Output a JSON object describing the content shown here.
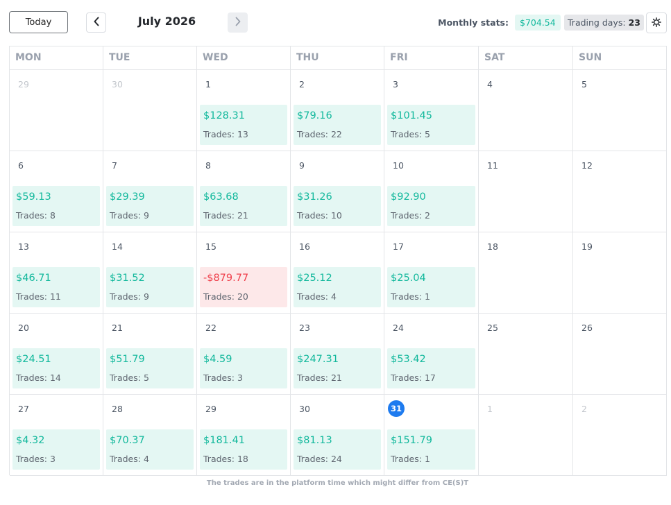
{
  "toolbar": {
    "today_label": "Today",
    "month_title": "July 2026",
    "stats_label": "Monthly stats:",
    "monthly_pnl": "$704.54",
    "trading_days_label": "Trading days:",
    "trading_days_value": "23",
    "icons": {
      "prev": "chevron-left-icon",
      "next": "chevron-right-icon",
      "settings": "gear-icon"
    }
  },
  "weekdays": [
    "MON",
    "TUE",
    "WED",
    "THU",
    "FRI",
    "SAT",
    "SUN"
  ],
  "trades_label": "Trades:",
  "colors": {
    "profit": "#12b89c",
    "profit_bg": "#e4f7f3",
    "loss": "#ef3e4a",
    "loss_bg": "#fde8e9",
    "today": "#1e7bef"
  },
  "weeks": [
    [
      {
        "day": "29",
        "muted": true
      },
      {
        "day": "30",
        "muted": true
      },
      {
        "day": "1",
        "pnl": "$128.31",
        "trades": "13"
      },
      {
        "day": "2",
        "pnl": "$79.16",
        "trades": "22"
      },
      {
        "day": "3",
        "pnl": "$101.45",
        "trades": "5"
      },
      {
        "day": "4"
      },
      {
        "day": "5"
      }
    ],
    [
      {
        "day": "6",
        "pnl": "$59.13",
        "trades": "8"
      },
      {
        "day": "7",
        "pnl": "$29.39",
        "trades": "9"
      },
      {
        "day": "8",
        "pnl": "$63.68",
        "trades": "21"
      },
      {
        "day": "9",
        "pnl": "$31.26",
        "trades": "10"
      },
      {
        "day": "10",
        "pnl": "$92.90",
        "trades": "2"
      },
      {
        "day": "11"
      },
      {
        "day": "12"
      }
    ],
    [
      {
        "day": "13",
        "pnl": "$46.71",
        "trades": "11"
      },
      {
        "day": "14",
        "pnl": "$31.52",
        "trades": "9"
      },
      {
        "day": "15",
        "pnl": "-$879.77",
        "trades": "20",
        "loss": true
      },
      {
        "day": "16",
        "pnl": "$25.12",
        "trades": "4"
      },
      {
        "day": "17",
        "pnl": "$25.04",
        "trades": "1"
      },
      {
        "day": "18"
      },
      {
        "day": "19"
      }
    ],
    [
      {
        "day": "20",
        "pnl": "$24.51",
        "trades": "14"
      },
      {
        "day": "21",
        "pnl": "$51.79",
        "trades": "5"
      },
      {
        "day": "22",
        "pnl": "$4.59",
        "trades": "3"
      },
      {
        "day": "23",
        "pnl": "$247.31",
        "trades": "21"
      },
      {
        "day": "24",
        "pnl": "$53.42",
        "trades": "17"
      },
      {
        "day": "25"
      },
      {
        "day": "26"
      }
    ],
    [
      {
        "day": "27",
        "pnl": "$4.32",
        "trades": "3"
      },
      {
        "day": "28",
        "pnl": "$70.37",
        "trades": "4"
      },
      {
        "day": "29",
        "pnl": "$181.41",
        "trades": "18"
      },
      {
        "day": "30",
        "pnl": "$81.13",
        "trades": "24"
      },
      {
        "day": "31",
        "pnl": "$151.79",
        "trades": "1",
        "today": true
      },
      {
        "day": "1",
        "muted": true
      },
      {
        "day": "2",
        "muted": true
      }
    ]
  ],
  "footnote": "The trades are in the platform time which might differ from CE(S)T"
}
